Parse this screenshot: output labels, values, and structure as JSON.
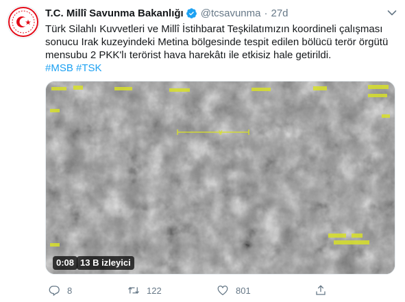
{
  "tweet": {
    "author_name": "T.C. Millî Savunma Bakanlığı",
    "handle": "@tcsavunma",
    "separator": "·",
    "time": "27d",
    "text_lines": [
      "Türk Silahlı Kuvvetleri ve Millî İstihbarat Teşkilatımızın koordineli çalışması",
      "sonucu Irak kuzeyindeki Metina bölgesinde tespit edilen bölücü terör örgütü",
      "mensubu 2 PKK'lı terörist hava harekâtı ile etkisiz hale getirildi."
    ],
    "hashtags": [
      "#MSB",
      "#TSK"
    ]
  },
  "video": {
    "duration": "0:08",
    "views": "13 B izleyici"
  },
  "actions": {
    "replies": "8",
    "retweets": "122",
    "likes": "801"
  },
  "colors": {
    "link": "#1da1f2",
    "muted": "#657786",
    "text": "#14171a",
    "logo_red": "#e30a17"
  },
  "icons": [
    "verified-icon",
    "caret-down-icon",
    "reply-icon",
    "retweet-icon",
    "like-icon",
    "share-icon"
  ]
}
